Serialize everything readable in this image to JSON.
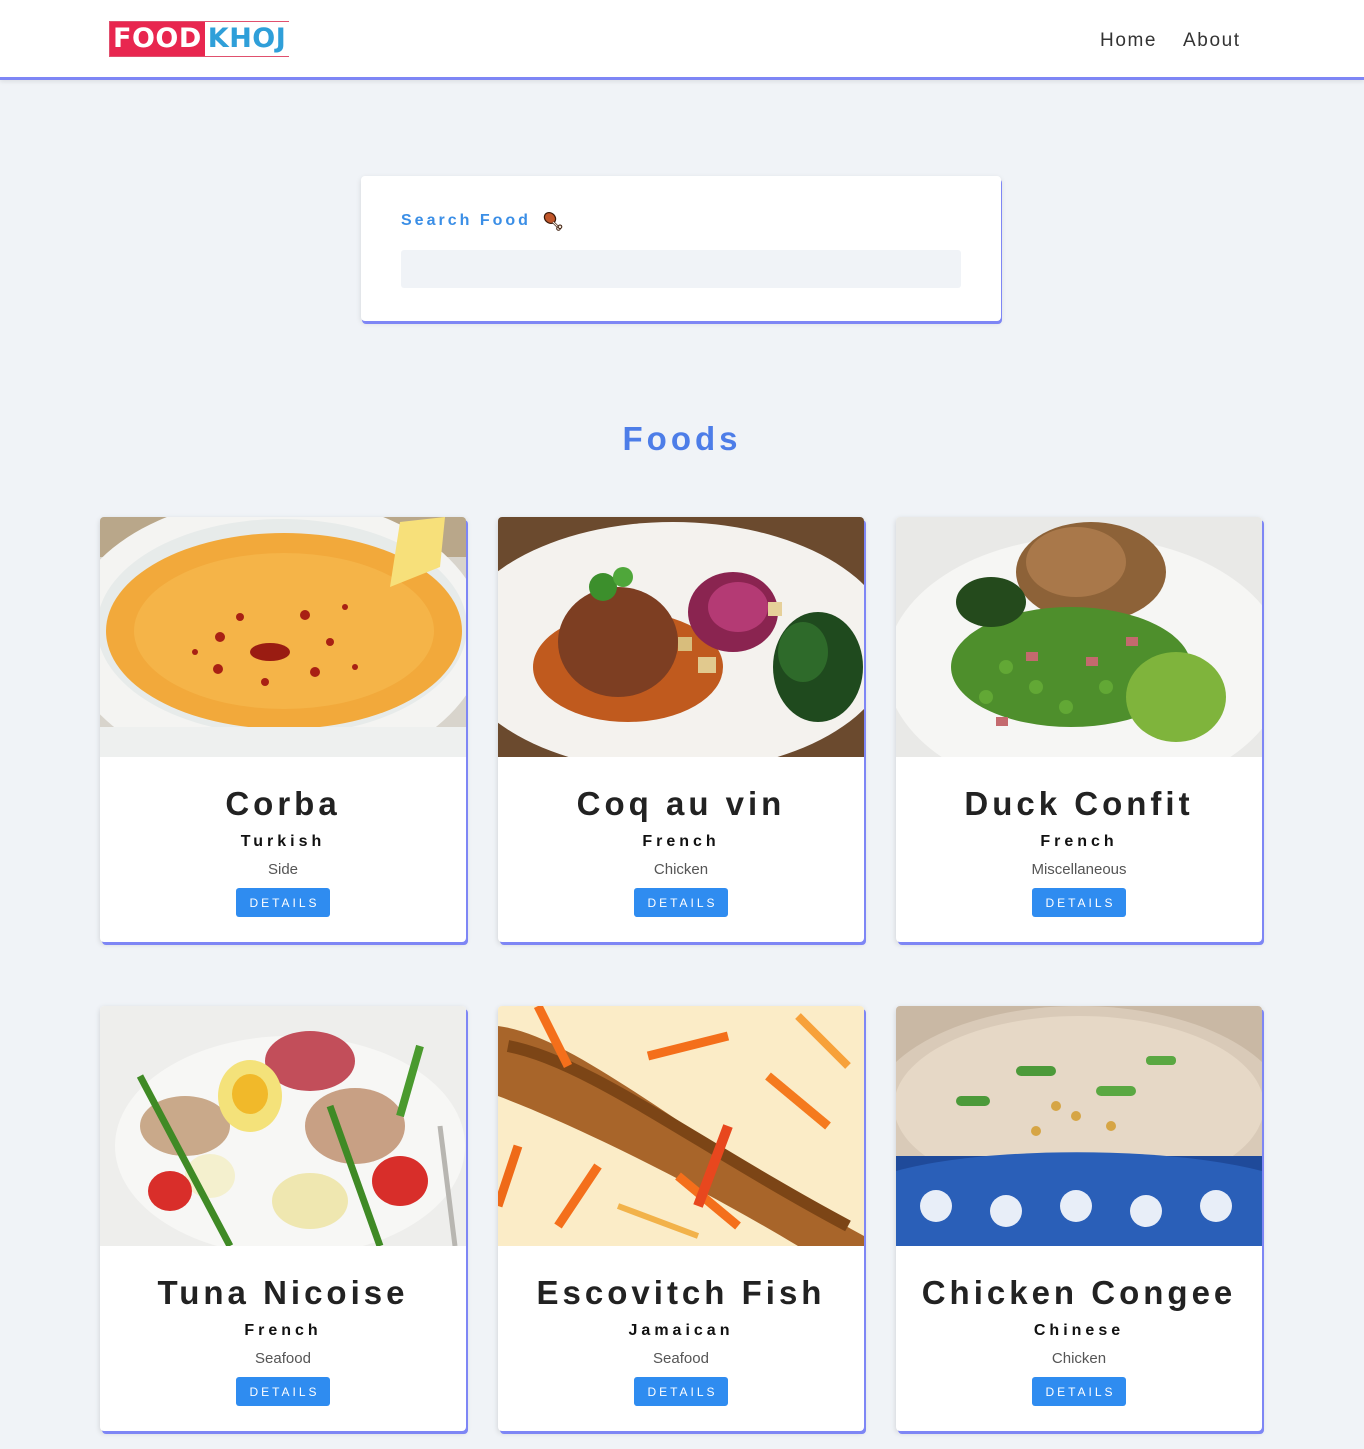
{
  "navbar": {
    "logo": {
      "part1": "FOOD",
      "part2": "KHOJ"
    },
    "links": [
      {
        "label": "Home"
      },
      {
        "label": "About"
      }
    ]
  },
  "search": {
    "label": "Search Food",
    "icon": "drumstick-icon",
    "value": "",
    "placeholder": ""
  },
  "section_title": "Foods",
  "foods": [
    {
      "name": "Corba",
      "area": "Turkish",
      "category": "Side",
      "button": "DETAILS",
      "image": "lentil-soup-photo"
    },
    {
      "name": "Coq au vin",
      "area": "French",
      "category": "Chicken",
      "button": "DETAILS",
      "image": "coq-au-vin-photo"
    },
    {
      "name": "Duck Confit",
      "area": "French",
      "category": "Miscellaneous",
      "button": "DETAILS",
      "image": "duck-confit-photo"
    },
    {
      "name": "Tuna Nicoise",
      "area": "French",
      "category": "Seafood",
      "button": "DETAILS",
      "image": "tuna-nicoise-photo"
    },
    {
      "name": "Escovitch Fish",
      "area": "Jamaican",
      "category": "Seafood",
      "button": "DETAILS",
      "image": "escovitch-fish-photo"
    },
    {
      "name": "Chicken Congee",
      "area": "Chinese",
      "category": "Chicken",
      "button": "DETAILS",
      "image": "chicken-congee-photo"
    }
  ],
  "colors": {
    "accent_border": "#7e86f5",
    "title_blue": "#4d7de8",
    "button_blue": "#2f8cf0",
    "logo_red": "#e8264f",
    "logo_blue": "#2f9fd9"
  }
}
